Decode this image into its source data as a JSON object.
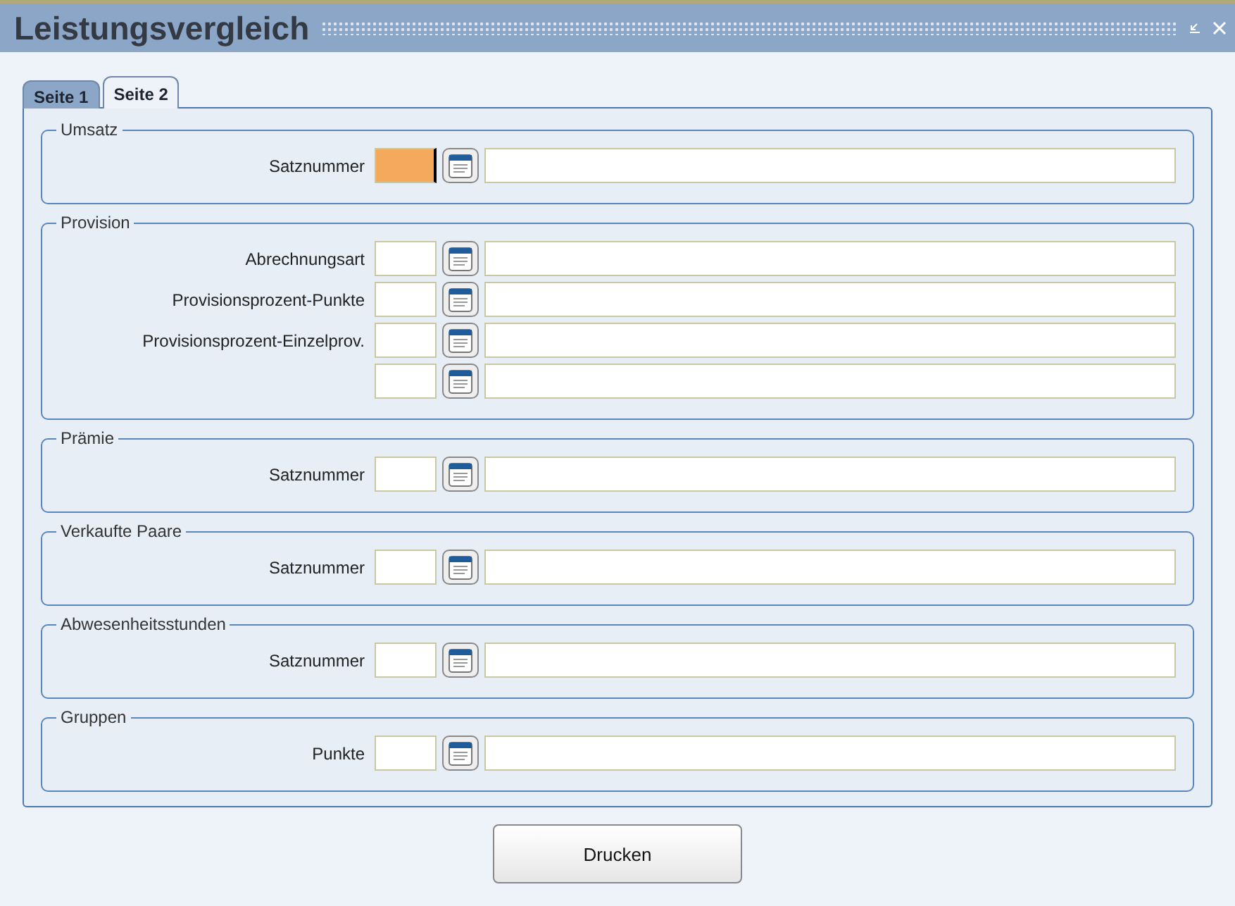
{
  "window": {
    "title": "Leistungsvergleich"
  },
  "tabs": [
    {
      "label": "Seite 1",
      "selected": false
    },
    {
      "label": "Seite 2",
      "selected": true
    }
  ],
  "groups": [
    {
      "title": "Umsatz",
      "rows": [
        {
          "label": "Satznummer",
          "focused": true
        }
      ]
    },
    {
      "title": "Provision",
      "rows": [
        {
          "label": "Abrechnungsart",
          "focused": false
        },
        {
          "label": "Provisionsprozent-Punkte",
          "focused": false
        },
        {
          "label": "Provisionsprozent-Einzelprov.",
          "focused": false
        },
        {
          "focused": false
        }
      ]
    },
    {
      "title": "Prämie",
      "rows": [
        {
          "label": "Satznummer",
          "focused": false
        }
      ]
    },
    {
      "title": "Verkaufte Paare",
      "rows": [
        {
          "label": "Satznummer",
          "focused": false
        }
      ]
    },
    {
      "title": "Abwesenheitsstunden",
      "rows": [
        {
          "label": "Satznummer",
          "focused": false
        }
      ]
    },
    {
      "title": "Gruppen",
      "rows": [
        {
          "label": "Punkte",
          "focused": false
        }
      ]
    }
  ],
  "buttons": [
    "Drucken"
  ]
}
